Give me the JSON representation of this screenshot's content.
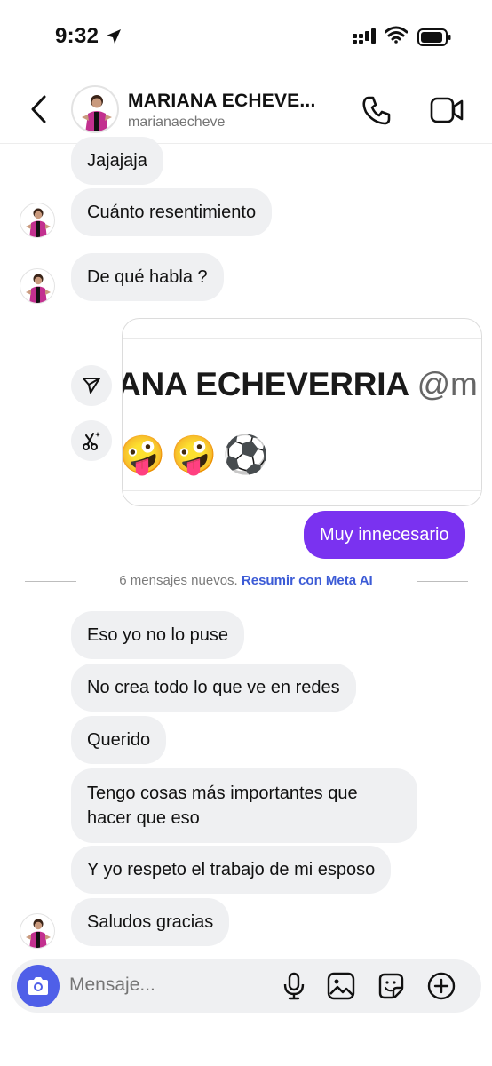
{
  "status_bar": {
    "time": "9:32"
  },
  "header": {
    "name": "MARIANA ECHEVE...",
    "handle": "marianaecheve",
    "icons": [
      "back-chevron-icon",
      "phone-icon",
      "video-camera-icon"
    ]
  },
  "messages": {
    "m1": "Jajajaja",
    "m2": "Cuánto resentimiento",
    "m3": "De qué habla ?",
    "shared_media": {
      "headline": "ANA ECHEVERRIA",
      "handle": "@m",
      "emoji": "🤪🤪⚽"
    },
    "m4": "Muy innecesario",
    "divider_text": "6 mensajes nuevos.",
    "divider_link": "Resumir con Meta AI",
    "m5": "Eso yo no lo puse",
    "m6": "No crea todo lo que ve en redes",
    "m7": "Querido",
    "m8": "Tengo cosas más importantes que hacer que eso",
    "m9": "Y yo respeto el trabajo de mi esposo",
    "m10": "Saludos gracias"
  },
  "composer": {
    "placeholder": "Mensaje...",
    "icons": [
      "camera-icon",
      "microphone-icon",
      "gallery-icon",
      "sticker-icon",
      "plus-icon"
    ]
  },
  "colors": {
    "accent_bubble": "#7a32f0",
    "camera_button": "#4f5fe8",
    "incoming_bubble": "#eff0f2",
    "link": "#3c5bd6"
  }
}
